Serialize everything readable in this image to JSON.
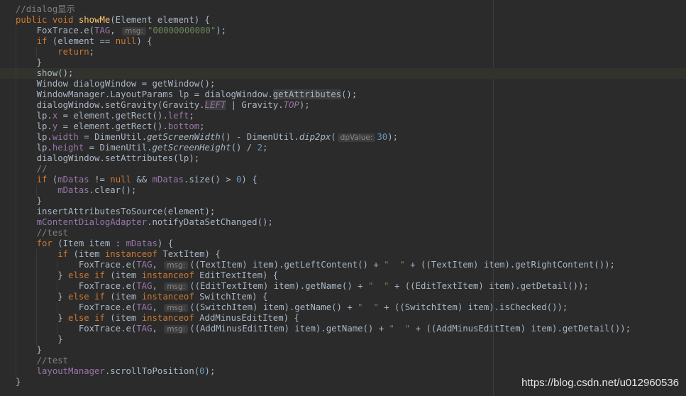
{
  "code": {
    "l01": "//dialog显示",
    "l02a": "public",
    "l02b": "void",
    "l02c": "showMe",
    "l02d": "(Element element) {",
    "l03a": "FoxTrace.e(",
    "l03b": "TAG",
    "l03c": ", ",
    "l03h": "msg:",
    "l03d": "\"00000000000\"",
    "l03e": ");",
    "l04a": "if",
    "l04b": " (element == ",
    "l04c": "null",
    "l04d": ") {",
    "l05a": "return",
    "l05b": ";",
    "l06": "}",
    "l07": "show();",
    "l08": "Window dialogWindow = getWindow();",
    "l09a": "WindowManager.LayoutParams lp = dialogWindow.",
    "l09b": "getAttributes",
    "l09c": "();",
    "l10a": "dialogWindow.setGravity(Gravity.",
    "l10b": "LEFT",
    "l10c": " | Gravity.",
    "l10d": "TOP",
    "l10e": ");",
    "l11a": "lp.",
    "l11b": "x",
    "l11c": " = element.getRect().",
    "l11d": "left",
    "l11e": ";",
    "l12a": "lp.",
    "l12b": "y",
    "l12c": " = element.getRect().",
    "l12d": "bottom",
    "l12e": ";",
    "l13a": "lp.",
    "l13b": "width",
    "l13c": " = DimenUtil.",
    "l13d": "getScreenWidth",
    "l13e": "() - DimenUtil.",
    "l13f": "dip2px",
    "l13g": "(",
    "l13h": "dpValue:",
    "l13i": "30",
    "l13j": ");",
    "l14a": "lp.",
    "l14b": "height",
    "l14c": " = DimenUtil.",
    "l14d": "getScreenHeight",
    "l14e": "() / ",
    "l14f": "2",
    "l14g": ";",
    "l15": "dialogWindow.setAttributes(lp);",
    "l16": "//",
    "l17a": "if",
    "l17b": " (",
    "l17c": "mDatas",
    "l17d": " != ",
    "l17e": "null",
    "l17f": " && ",
    "l17g": "mDatas",
    "l17h": ".size() > ",
    "l17i": "0",
    "l17j": ") {",
    "l18a": "mDatas",
    "l18b": ".clear();",
    "l19": "}",
    "l20": "insertAttributesToSource(element);",
    "l21a": "mContentDialogAdapter",
    "l21b": ".notifyDataSetChanged();",
    "l22": "//test",
    "l23a": "for",
    "l23b": " (Item item : ",
    "l23c": "mDatas",
    "l23d": ") {",
    "l24a": "if",
    "l24b": " (item ",
    "l24c": "instanceof",
    "l24d": " TextItem) {",
    "l25a": "FoxTrace.e(",
    "l25b": "TAG",
    "l25c": ", ",
    "l25h": "msg:",
    "l25d": "((TextItem) item).getLeftContent() + ",
    "l25e": "\"  \"",
    "l25f": " + ((TextItem) item).getRightContent());",
    "l26a": "} ",
    "l26b": "else if",
    "l26c": " (item ",
    "l26d": "instanceof",
    "l26e": " EditTextItem) {",
    "l27a": "FoxTrace.e(",
    "l27b": "TAG",
    "l27c": ", ",
    "l27h": "msg:",
    "l27d": "((EditTextItem) item).getName() + ",
    "l27e": "\"  \"",
    "l27f": " + ((EditTextItem) item).getDetail());",
    "l28a": "} ",
    "l28b": "else if",
    "l28c": " (item ",
    "l28d": "instanceof",
    "l28e": " SwitchItem) {",
    "l29a": "FoxTrace.e(",
    "l29b": "TAG",
    "l29c": ", ",
    "l29h": "msg:",
    "l29d": "((SwitchItem) item).getName() + ",
    "l29e": "\"  \"",
    "l29f": " + ((SwitchItem) item).isChecked());",
    "l30a": "} ",
    "l30b": "else if",
    "l30c": " (item ",
    "l30d": "instanceof",
    "l30e": " AddMinusEditItem) {",
    "l31a": "FoxTrace.e(",
    "l31b": "TAG",
    "l31c": ", ",
    "l31h": "msg:",
    "l31d": "((AddMinusEditItem) item).getName() + ",
    "l31e": "\"  \"",
    "l31f": " + ((AddMinusEditItem) item).getDetail());",
    "l32": "}",
    "l33": "}",
    "l34": "//test",
    "l35a": "layoutManager",
    "l35b": ".scrollToPosition(",
    "l35c": "0",
    "l35d": ");",
    "l36": "}"
  },
  "watermark": "https://blog.csdn.net/u012960536",
  "colors": {
    "background": "#2b2b2b",
    "keyword": "#cc7832",
    "comment": "#808080",
    "string": "#6a8759",
    "number": "#6897bb",
    "field": "#9876aa",
    "method_decl": "#ffc66d",
    "text": "#a9b7c6"
  }
}
